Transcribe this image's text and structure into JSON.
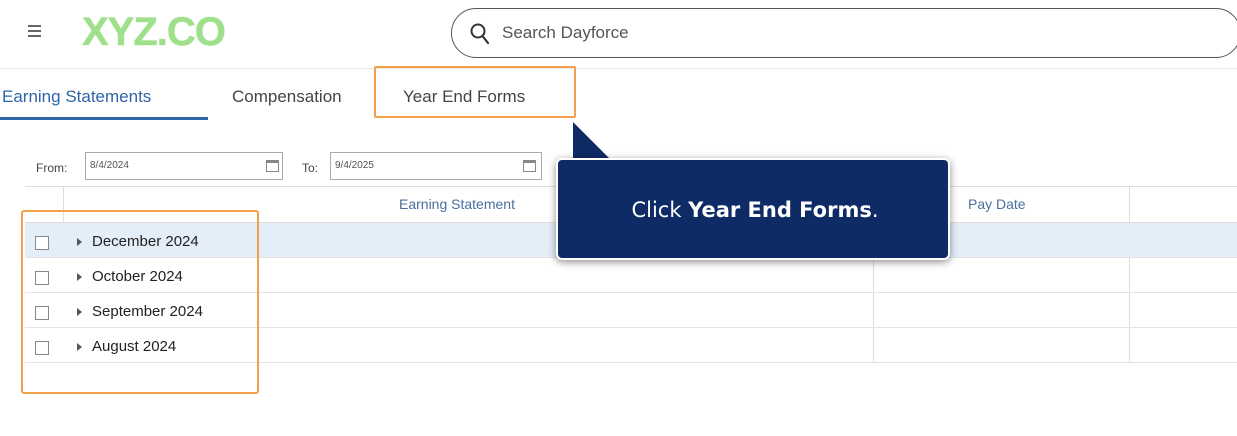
{
  "header": {
    "logo_text": "XYZ.CO",
    "search_placeholder": "Search Dayforce"
  },
  "tabs": [
    {
      "label": "Earning Statements",
      "active": true
    },
    {
      "label": "Compensation",
      "active": false
    },
    {
      "label": "Year End Forms",
      "active": false
    }
  ],
  "filter": {
    "from_label": "From:",
    "from_value": "8/4/2024",
    "to_label": "To:",
    "to_value": "9/4/2025"
  },
  "grid": {
    "columns": [
      "Earning Statement",
      "Pay Date"
    ],
    "rows": [
      {
        "label": "December 2024",
        "selected": true
      },
      {
        "label": "October 2024",
        "selected": false
      },
      {
        "label": "September 2024",
        "selected": false
      },
      {
        "label": "August 2024",
        "selected": false
      }
    ]
  },
  "callout": {
    "prefix": "Click ",
    "target": "Year End Forms",
    "suffix": "."
  },
  "colors": {
    "accent": "#2f64a7",
    "highlight": "#f0a14a",
    "callout_bg": "#0f2b66",
    "logo": "#9fe08a",
    "selected_row": "#e4eef9"
  }
}
